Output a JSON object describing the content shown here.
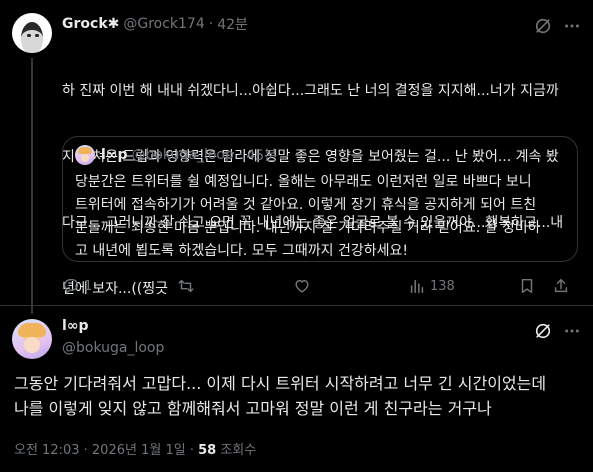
{
  "reply": {
    "author_name": "Grock✱",
    "author_handle": "@Grock174",
    "time": "42분",
    "text_lines": [
      "하 진짜 이번 해 내내 쉬겠다니...아쉽다...그래도 난 너의 결정을 지지해...너가 지금까",
      "지 펼쳐온 드립과 영향력은 탐라에 정말 좋은 영향을 보어줬는 걸... 난 봤어... 계속 봤",
      "다구... 그러니까 잘 쉬고 오면 꼭 내년에는 좋은 얼굴로 볼 수 있을꺼야...행복하고...내",
      "년에 보자...((찡긋"
    ],
    "quote": {
      "author_name": "l∞p",
      "author_handle": "@bokuga_loop",
      "time": "45분",
      "text_lines": [
        "당분간은 트위터를 쉴 예정입니다. 올해는 아무래도 이런저런 일로 바쁘다 보니",
        "트위터에 접속하기가 어려울 것 같아요. 이렇게 장기 휴식을 공지하게 되어 트친",
        "분들께는 죄송한 마음 뿐입니다. 내년까지 잘 기다려주실 거라 믿어요. 잘 정비하",
        "고 내년에 뵙도록 하겠습니다. 모두 그때까지 건강하세요!"
      ]
    },
    "actions": {
      "reply_count": "1",
      "retweet_count": "",
      "like_count": "",
      "views_count": "138"
    }
  },
  "main": {
    "author_name": "l∞p",
    "author_handle": "@bokuga_loop",
    "text_lines": [
      "그동안 기다려줘서 고맙다... 이제 다시 트위터 시작하려고 너무 긴 시간이었는데",
      "나를 이렇게 잊지 않고 함께해줘서 고마워 정말 이런 게 친구라는 거구나"
    ],
    "timestamp": "오전 12:03 · 2026년 1월 1일 · ",
    "views": "58",
    "views_label": " 조회수"
  },
  "icons": [
    "grok-icon",
    "more-icon",
    "reply-icon",
    "retweet-icon",
    "like-icon",
    "views-icon",
    "bookmark-icon",
    "share-icon"
  ],
  "colors": {
    "background": "#000000",
    "text": "#e7e9ea",
    "muted": "#71767b",
    "border": "#2f3336"
  }
}
